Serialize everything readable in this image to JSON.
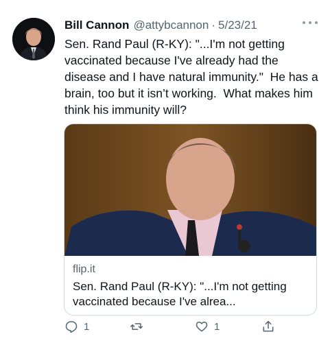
{
  "tweet": {
    "author_name": "Bill Cannon",
    "handle": "@attybcannon",
    "separator": "·",
    "date": "5/23/21",
    "text": "Sen. Rand Paul (R-KY): \"...I'm not getting vaccinated because I've already had the disease and I have natural immunity.\"  He has a brain, too but it isn’t working.  What makes him think his immunity will?",
    "more_icon": "more-horizontal-icon"
  },
  "card": {
    "domain": "flip.it",
    "title": "Sen. Rand Paul (R-KY): \"...I'm not getting vaccinated because I've alrea..."
  },
  "actions": {
    "reply": {
      "icon": "reply-icon",
      "count": "1"
    },
    "retweet": {
      "icon": "retweet-icon",
      "count": ""
    },
    "like": {
      "icon": "heart-icon",
      "count": "1"
    },
    "share": {
      "icon": "share-icon",
      "count": ""
    }
  },
  "colors": {
    "text": "#0f1419",
    "secondary": "#536471",
    "border": "#cfd9de"
  }
}
